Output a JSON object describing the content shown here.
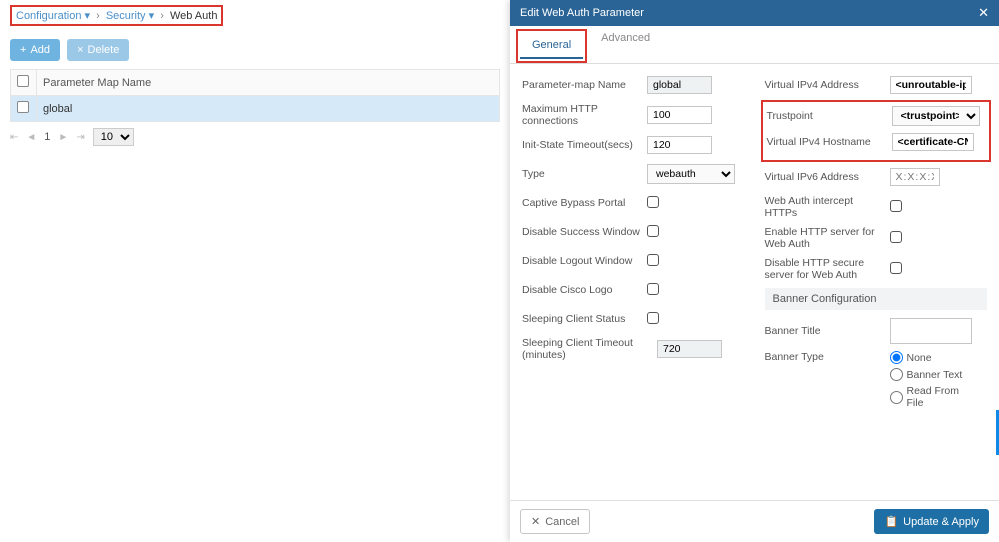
{
  "breadcrumb": {
    "item1": "Configuration ▾",
    "item2": "Security ▾",
    "current": "Web Auth"
  },
  "actions": {
    "add": "Add",
    "delete": "Delete"
  },
  "table": {
    "col1": "Parameter Map Name",
    "row1": "global"
  },
  "pager": {
    "page": "1",
    "size": "10"
  },
  "panel": {
    "title": "Edit Web Auth Parameter",
    "tabs": {
      "general": "General",
      "advanced": "Advanced"
    },
    "left": {
      "pmap_label": "Parameter-map Name",
      "pmap_val": "global",
      "maxconn_label": "Maximum HTTP connections",
      "maxconn_val": "100",
      "initstate_label": "Init-State Timeout(secs)",
      "initstate_val": "120",
      "type_label": "Type",
      "type_val": "webauth",
      "captive_label": "Captive Bypass Portal",
      "dsuccess_label": "Disable Success Window",
      "dlogout_label": "Disable Logout Window",
      "dcisco_label": "Disable Cisco Logo",
      "sleep_label": "Sleeping Client Status",
      "sleeptimeout_label": "Sleeping Client Timeout (minutes)",
      "sleeptimeout_val": "720"
    },
    "right": {
      "v4addr_label": "Virtual IPv4 Address",
      "v4addr_val": "<unroutable-ip>",
      "trust_label": "Trustpoint",
      "trust_val": "<trustpoint>",
      "v4host_label": "Virtual IPv4 Hostname",
      "v4host_val": "<certificate-CN>",
      "v6addr_label": "Virtual IPv6 Address",
      "v6addr_ph": "X:X:X:X::X",
      "intercept_label": "Web Auth intercept HTTPs",
      "httpen_label": "Enable HTTP server for Web Auth",
      "httpdis_label": "Disable HTTP secure server for Web Auth",
      "banner_section": "Banner Configuration",
      "btitle_label": "Banner Title",
      "btype_label": "Banner Type",
      "radios": {
        "none": "None",
        "text": "Banner Text",
        "file": "Read From File"
      }
    },
    "footer": {
      "cancel": "Cancel",
      "apply": "Update & Apply"
    }
  }
}
